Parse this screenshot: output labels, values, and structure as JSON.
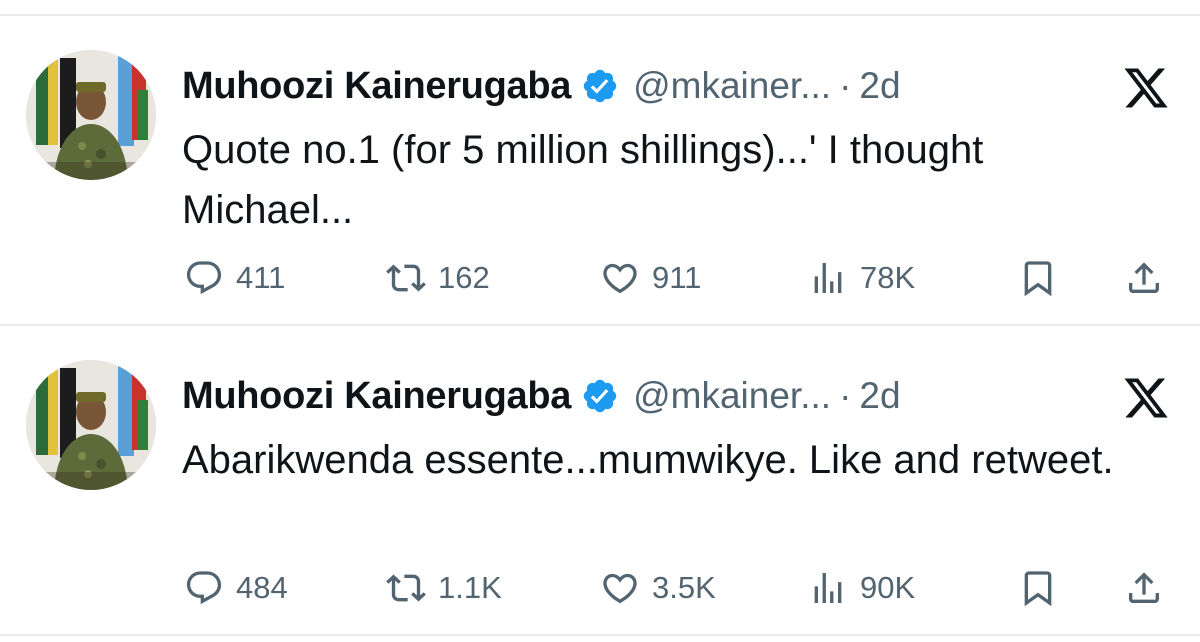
{
  "tweets": [
    {
      "author_name": "Muhoozi Kainerugaba",
      "handle": "@mkainer...",
      "separator": "·",
      "time": "2d",
      "text": "Quote no.1 (for 5 million shillings)...' I thought Michael...",
      "replies": "411",
      "retweets": "162",
      "likes": "911",
      "views": "78K"
    },
    {
      "author_name": "Muhoozi Kainerugaba",
      "handle": "@mkainer...",
      "separator": "·",
      "time": "2d",
      "text": "Abarikwenda essente...mumwikye. Like and retweet.",
      "replies": "484",
      "retweets": "1.1K",
      "likes": "3.5K",
      "views": "90K"
    }
  ],
  "icons": {
    "verified": "verified-badge-icon",
    "logo": "x-logo-icon",
    "reply": "reply-icon",
    "retweet": "retweet-icon",
    "like": "heart-icon",
    "views": "views-icon",
    "bookmark": "bookmark-icon",
    "share": "share-icon"
  },
  "colors": {
    "verified_blue": "#1d9bf0",
    "secondary_text": "#536471",
    "primary_text": "#0f1419",
    "divider": "#e7e9eb"
  }
}
